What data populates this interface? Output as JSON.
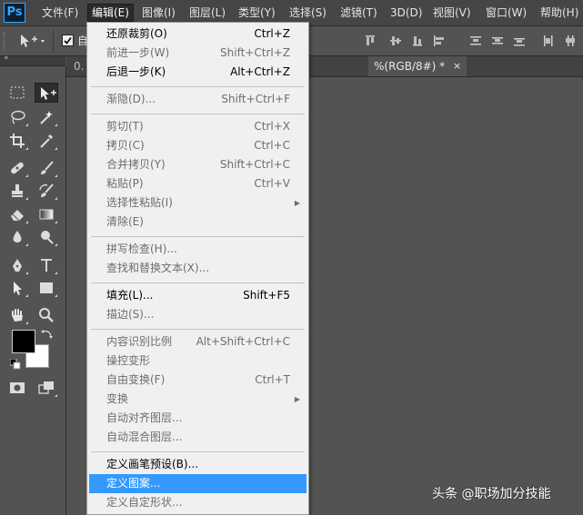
{
  "app": {
    "logo_text": "Ps",
    "accent": "#31a8ff"
  },
  "menubar": [
    {
      "label": "文件(F)"
    },
    {
      "label": "编辑(E)",
      "active": true
    },
    {
      "label": "图像(I)"
    },
    {
      "label": "图层(L)"
    },
    {
      "label": "类型(Y)"
    },
    {
      "label": "选择(S)"
    },
    {
      "label": "滤镜(T)"
    },
    {
      "label": "3D(D)"
    },
    {
      "label": "视图(V)"
    },
    {
      "label": "窗口(W)"
    },
    {
      "label": "帮助(H)"
    }
  ],
  "optionsbar": {
    "checkbox_label": "自"
  },
  "tabs": {
    "left_partial": "0.",
    "document": "%(RGB/8#) *",
    "close": "×"
  },
  "edit_menu": {
    "items": [
      {
        "label": "还原裁剪(O)",
        "shortcut": "Ctrl+Z",
        "state": "enabled"
      },
      {
        "label": "前进一步(W)",
        "shortcut": "Shift+Ctrl+Z",
        "state": "disabled"
      },
      {
        "label": "后退一步(K)",
        "shortcut": "Alt+Ctrl+Z",
        "state": "enabled"
      },
      {
        "label": "渐隐(D)...",
        "shortcut": "Shift+Ctrl+F",
        "state": "disabled"
      },
      {
        "label": "剪切(T)",
        "shortcut": "Ctrl+X",
        "state": "disabled"
      },
      {
        "label": "拷贝(C)",
        "shortcut": "Ctrl+C",
        "state": "disabled"
      },
      {
        "label": "合并拷贝(Y)",
        "shortcut": "Shift+Ctrl+C",
        "state": "disabled"
      },
      {
        "label": "粘贴(P)",
        "shortcut": "Ctrl+V",
        "state": "disabled"
      },
      {
        "label": "选择性粘贴(I)",
        "shortcut": "",
        "state": "disabled",
        "submenu": true
      },
      {
        "label": "清除(E)",
        "shortcut": "",
        "state": "disabled"
      },
      {
        "label": "拼写检查(H)...",
        "shortcut": "",
        "state": "disabled"
      },
      {
        "label": "查找和替换文本(X)...",
        "shortcut": "",
        "state": "disabled"
      },
      {
        "label": "填充(L)...",
        "shortcut": "Shift+F5",
        "state": "enabled"
      },
      {
        "label": "描边(S)...",
        "shortcut": "",
        "state": "disabled"
      },
      {
        "label": "内容识别比例",
        "shortcut": "Alt+Shift+Ctrl+C",
        "state": "disabled"
      },
      {
        "label": "操控变形",
        "shortcut": "",
        "state": "disabled"
      },
      {
        "label": "自由变换(F)",
        "shortcut": "Ctrl+T",
        "state": "disabled"
      },
      {
        "label": "变换",
        "shortcut": "",
        "state": "disabled",
        "submenu": true
      },
      {
        "label": "自动对齐图层...",
        "shortcut": "",
        "state": "disabled"
      },
      {
        "label": "自动混合图层...",
        "shortcut": "",
        "state": "disabled"
      },
      {
        "label": "定义画笔预设(B)...",
        "shortcut": "",
        "state": "enabled"
      },
      {
        "label": "定义图案...",
        "shortcut": "",
        "state": "highlighted"
      },
      {
        "label": "定义自定形状...",
        "shortcut": "",
        "state": "disabled"
      }
    ]
  },
  "colors": {
    "foreground": "#000000",
    "background": "#ffffff",
    "highlight": "#3399ff"
  },
  "watermark": "头条 @职场加分技能"
}
